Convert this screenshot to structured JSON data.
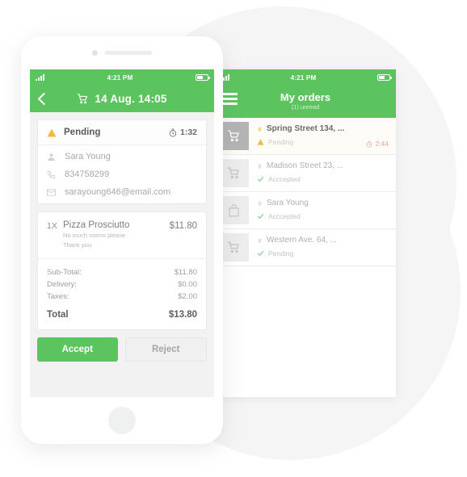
{
  "order_detail_screen": {
    "statusbar": {
      "time": "4:21 PM",
      "signal_icon": "signal-bars-icon",
      "battery_icon": "battery-icon"
    },
    "navbar": {
      "back_icon": "back-chevron-icon",
      "cart_icon": "shopping-cart-icon",
      "title": "14 Aug. 14:05"
    },
    "status_card": {
      "warning_icon": "warning-triangle-icon",
      "status": "Pending",
      "timer_icon": "stopwatch-icon",
      "timer": "1:32"
    },
    "contact": [
      {
        "icon": "person-icon",
        "text": "Sara Young"
      },
      {
        "icon": "phone-icon",
        "text": "834758299"
      },
      {
        "icon": "envelope-icon",
        "text": "sarayoung646@email.com"
      }
    ],
    "items": [
      {
        "qty": "1X",
        "name": "Pizza Prosciutto",
        "note_line1": "No much rooms please",
        "note_line2": "Thank you",
        "price": "$11.80"
      }
    ],
    "totals": [
      {
        "label": "Sub-Total:",
        "value": "$11.80"
      },
      {
        "label": "Delivery:",
        "value": "$0.00"
      },
      {
        "label": "Taxes:",
        "value": "$2.00"
      }
    ],
    "grand_total": {
      "label": "Total",
      "value": "$13.80"
    },
    "accept_label": "Accept",
    "reject_label": "Reject"
  },
  "orders_list_screen": {
    "statusbar": {
      "time": "4:21 PM",
      "signal_icon": "signal-bars-icon",
      "battery_icon": "battery-icon"
    },
    "navbar": {
      "menu_icon": "hamburger-menu-icon",
      "title": "My orders",
      "subtitle": "(1) unread"
    },
    "rows": [
      {
        "thumb_icon": "shopping-cart-icon",
        "pin_icon": "location-pin-icon",
        "address": "Spring Street 134, ...",
        "status_icon": "warning-triangle-icon",
        "status": "Pending",
        "timer_icon": "stopwatch-icon",
        "timer": "2:44",
        "unread": true
      },
      {
        "thumb_icon": "shopping-cart-icon",
        "pin_icon": "location-pin-icon",
        "address": "Madison Street 23, ...",
        "status_icon": "check-icon",
        "status": "Acccepted",
        "timer": "",
        "unread": false
      },
      {
        "thumb_icon": "shopping-bag-icon",
        "pin_icon": "location-pin-icon",
        "address": "Sara Young",
        "status_icon": "check-icon",
        "status": "Acccepted",
        "timer": "",
        "unread": false
      },
      {
        "thumb_icon": "shopping-cart-icon",
        "pin_icon": "location-pin-icon",
        "address": "Western Ave. 64, ...",
        "status_icon": "check-icon",
        "status": "Pending",
        "timer": "",
        "unread": false
      }
    ]
  },
  "colors": {
    "brand_green": "#5cc45f",
    "warning_amber": "#f3b942",
    "timer_red": "#e9a0a0",
    "check_green": "#6cc46c",
    "background_circle": "#f5f5f6"
  }
}
